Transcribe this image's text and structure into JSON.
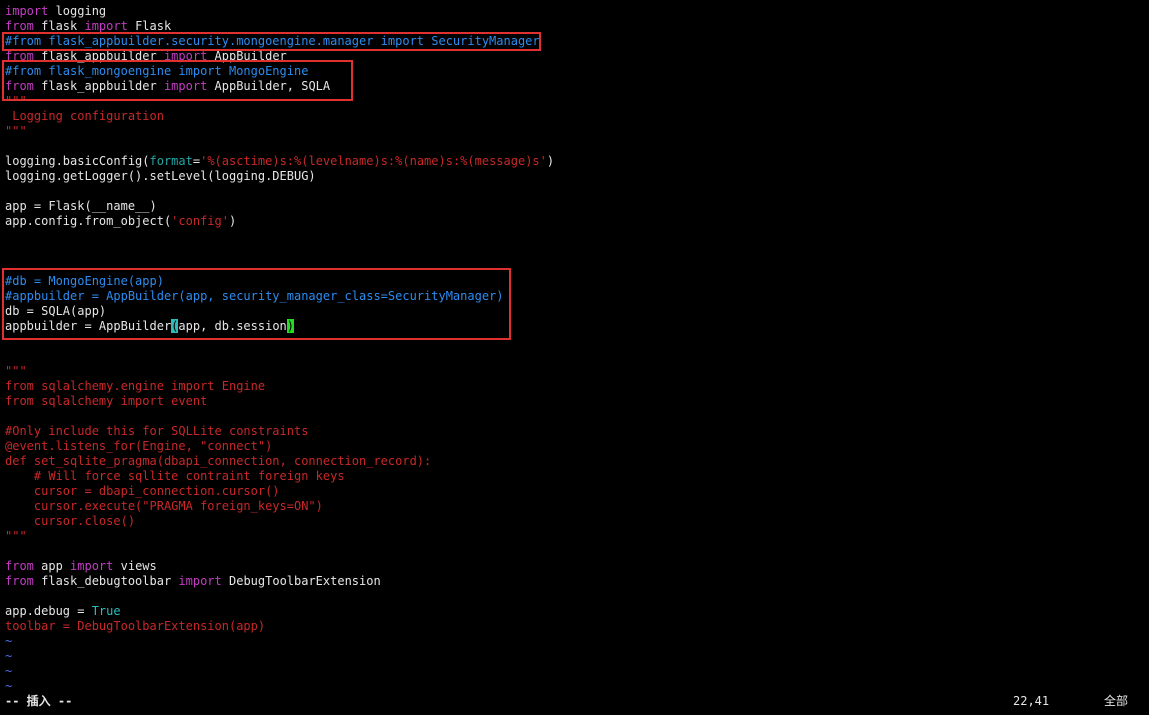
{
  "editor": {
    "lines": [
      [
        {
          "t": "import",
          "c": "keyword"
        },
        {
          "t": " logging",
          "c": "plain"
        }
      ],
      [
        {
          "t": "from",
          "c": "keyword"
        },
        {
          "t": " flask ",
          "c": "plain"
        },
        {
          "t": "import",
          "c": "keyword"
        },
        {
          "t": " Flask",
          "c": "plain"
        }
      ],
      [
        {
          "t": "#from flask_appbuilder.security.mongoengine.manager import SecurityManager",
          "c": "comment"
        }
      ],
      [
        {
          "t": "from",
          "c": "keyword"
        },
        {
          "t": " flask_appbuilder ",
          "c": "plain"
        },
        {
          "t": "import",
          "c": "keyword"
        },
        {
          "t": " AppBuilder",
          "c": "plain"
        }
      ],
      [
        {
          "t": "#from flask_mongoengine import MongoEngine",
          "c": "comment"
        }
      ],
      [
        {
          "t": "from",
          "c": "keyword"
        },
        {
          "t": " flask_appbuilder ",
          "c": "plain"
        },
        {
          "t": "import",
          "c": "keyword"
        },
        {
          "t": " AppBuilder, SQLA",
          "c": "plain"
        }
      ],
      [
        {
          "t": "\"\"\"",
          "c": "string"
        }
      ],
      [
        {
          "t": " Logging configuration",
          "c": "string"
        }
      ],
      [
        {
          "t": "\"\"\"",
          "c": "string"
        }
      ],
      [],
      [
        {
          "t": "logging.basicConfig(",
          "c": "plain"
        },
        {
          "t": "format",
          "c": "arg"
        },
        {
          "t": "=",
          "c": "plain"
        },
        {
          "t": "'%(asctime)s:%(levelname)s:%(name)s:%(message)s'",
          "c": "string"
        },
        {
          "t": ")",
          "c": "plain"
        }
      ],
      [
        {
          "t": "logging.getLogger().setLevel(logging.DEBUG)",
          "c": "plain"
        }
      ],
      [],
      [
        {
          "t": "app = Flask(__name__)",
          "c": "plain"
        }
      ],
      [
        {
          "t": "app.config.from_object(",
          "c": "plain"
        },
        {
          "t": "'config'",
          "c": "string"
        },
        {
          "t": ")",
          "c": "plain"
        }
      ],
      [],
      [],
      [],
      [
        {
          "t": "#db = MongoEngine(app)",
          "c": "comment"
        }
      ],
      [
        {
          "t": "#appbuilder = AppBuilder(app, security_manager_class=SecurityManager)",
          "c": "comment"
        }
      ],
      [
        {
          "t": "db = SQLA(app)",
          "c": "plain"
        }
      ],
      [
        {
          "t": "appbuilder = AppBuilder",
          "c": "plain"
        },
        {
          "t": "(",
          "c": "cursor-open"
        },
        {
          "t": "app, db.session",
          "c": "plain"
        },
        {
          "t": ")",
          "c": "cursor-close"
        }
      ],
      [],
      [],
      [
        {
          "t": "\"\"\"",
          "c": "string"
        }
      ],
      [
        {
          "t": "from sqlalchemy.engine import Engine",
          "c": "string"
        }
      ],
      [
        {
          "t": "from sqlalchemy import event",
          "c": "string"
        }
      ],
      [],
      [
        {
          "t": "#Only include this for SQLLite constraints",
          "c": "string"
        }
      ],
      [
        {
          "t": "@event.listens_for(Engine, \"connect\")",
          "c": "string"
        }
      ],
      [
        {
          "t": "def set_sqlite_pragma(dbapi_connection, connection_record):",
          "c": "string"
        }
      ],
      [
        {
          "t": "    # Will force sqllite contraint foreign keys",
          "c": "string"
        }
      ],
      [
        {
          "t": "    cursor = dbapi_connection.cursor()",
          "c": "string"
        }
      ],
      [
        {
          "t": "    cursor.execute(\"PRAGMA foreign_keys=ON\")",
          "c": "string"
        }
      ],
      [
        {
          "t": "    cursor.close()",
          "c": "string"
        }
      ],
      [
        {
          "t": "\"\"\"",
          "c": "string"
        }
      ],
      [],
      [
        {
          "t": "from",
          "c": "keyword"
        },
        {
          "t": " app ",
          "c": "plain"
        },
        {
          "t": "import",
          "c": "keyword"
        },
        {
          "t": " views",
          "c": "plain"
        }
      ],
      [
        {
          "t": "from",
          "c": "keyword"
        },
        {
          "t": " flask_debugtoolbar ",
          "c": "plain"
        },
        {
          "t": "import",
          "c": "keyword"
        },
        {
          "t": " DebugToolbarExtension",
          "c": "plain"
        }
      ],
      [],
      [
        {
          "t": "app.debug = ",
          "c": "plain"
        },
        {
          "t": "True",
          "c": "const"
        }
      ],
      [
        {
          "t": "toolbar = DebugToolbarExtension(app)",
          "c": "string"
        }
      ],
      [
        {
          "t": "~",
          "c": "tilde"
        }
      ],
      [
        {
          "t": "~",
          "c": "tilde"
        }
      ],
      [
        {
          "t": "~",
          "c": "tilde"
        }
      ],
      [
        {
          "t": "~",
          "c": "tilde"
        }
      ]
    ]
  },
  "statusbar": {
    "mode": "-- 插入 --",
    "cursor_pos": "22,41",
    "scroll_pos": "全部"
  },
  "colors": {
    "background": "#000000",
    "keyword": "#c43cc4",
    "comment": "#2c8cf0",
    "string": "#c82828",
    "highlight_box": "#e03030"
  }
}
